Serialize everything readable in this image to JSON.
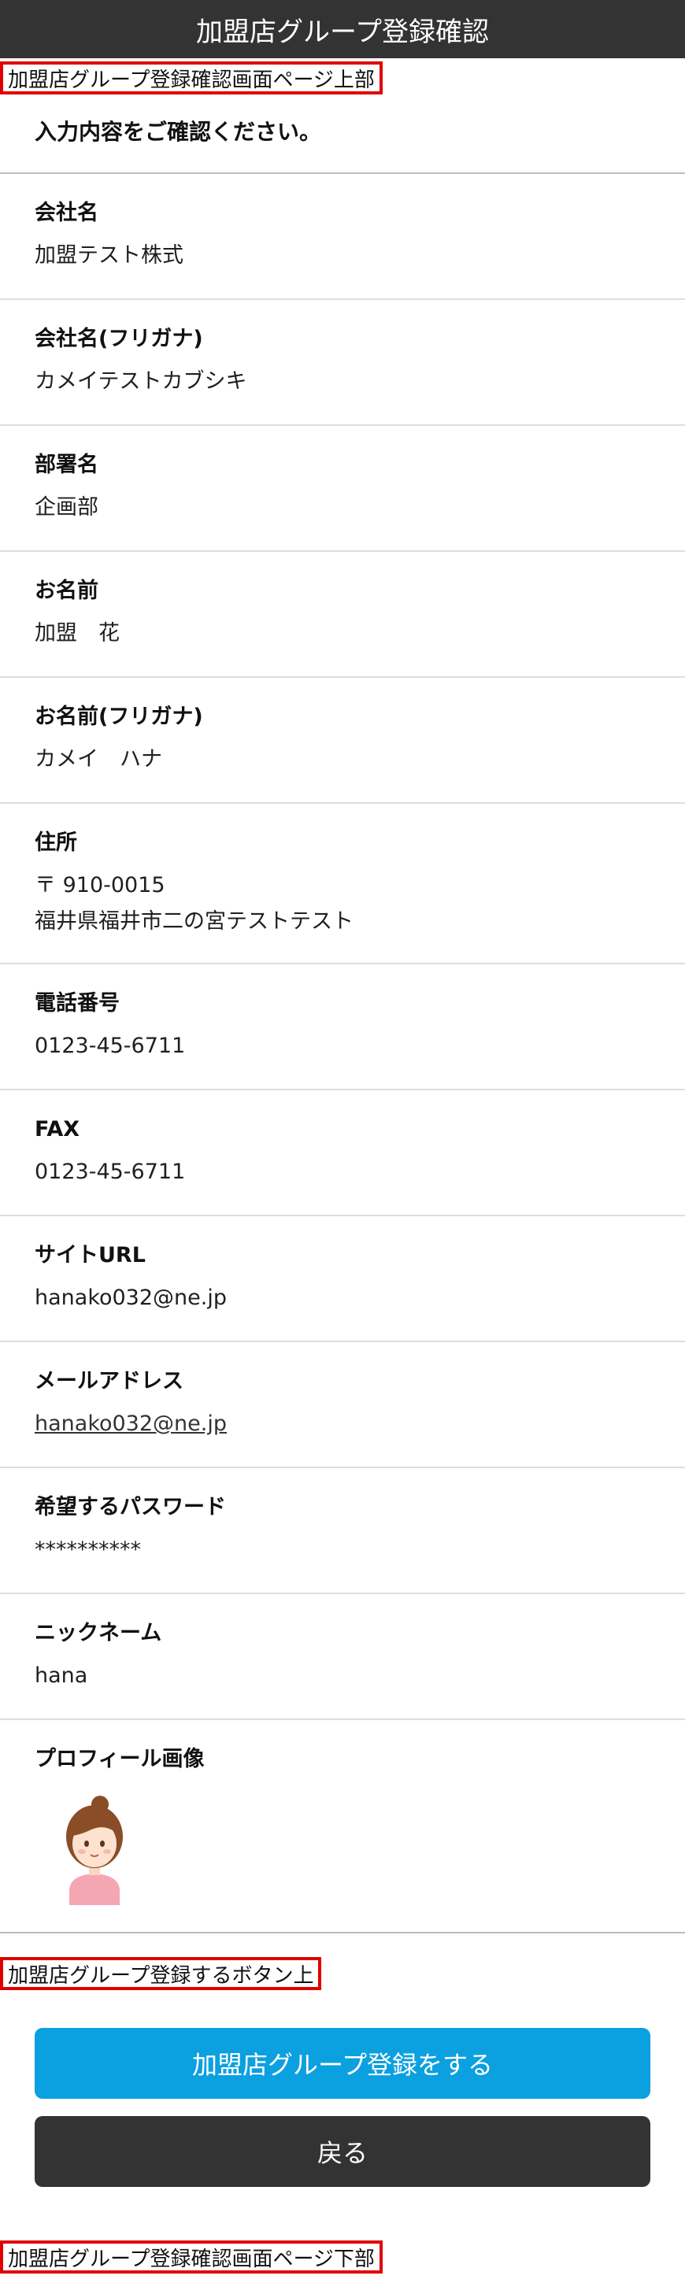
{
  "header": {
    "title": "加盟店グループ登録確認"
  },
  "markers": {
    "top": "加盟店グループ登録確認画面ページ上部",
    "above_button": "加盟店グループ登録するボタン上",
    "bottom": "加盟店グループ登録確認画面ページ下部"
  },
  "intro": "入力内容をご確認ください。",
  "fields": {
    "company": {
      "label": "会社名",
      "value": "加盟テスト株式"
    },
    "company_kana": {
      "label": "会社名(フリガナ)",
      "value": "カメイテストカブシキ"
    },
    "department": {
      "label": "部署名",
      "value": "企画部"
    },
    "name": {
      "label": "お名前",
      "value": "加盟　花"
    },
    "name_kana": {
      "label": "お名前(フリガナ)",
      "value": "カメイ　ハナ"
    },
    "address": {
      "label": "住所",
      "postal": "〒 910-0015",
      "line": "福井県福井市二の宮テストテスト"
    },
    "phone": {
      "label": "電話番号",
      "value": "0123-45-6711"
    },
    "fax": {
      "label": "FAX",
      "value": "0123-45-6711"
    },
    "site_url": {
      "label": "サイトURL",
      "value": "hanako032@ne.jp"
    },
    "email": {
      "label": "メールアドレス",
      "value": "hanako032@ne.jp"
    },
    "password": {
      "label": "希望するパスワード",
      "value": "**********"
    },
    "nickname": {
      "label": "ニックネーム",
      "value": "hana"
    },
    "profile_image": {
      "label": "プロフィール画像",
      "icon": "avatar-icon"
    }
  },
  "buttons": {
    "register": "加盟店グループ登録をする",
    "back": "戻る"
  },
  "colors": {
    "header_bg": "#333333",
    "primary": "#0ba0e0",
    "back": "#333333",
    "marker_border": "#e00000"
  }
}
